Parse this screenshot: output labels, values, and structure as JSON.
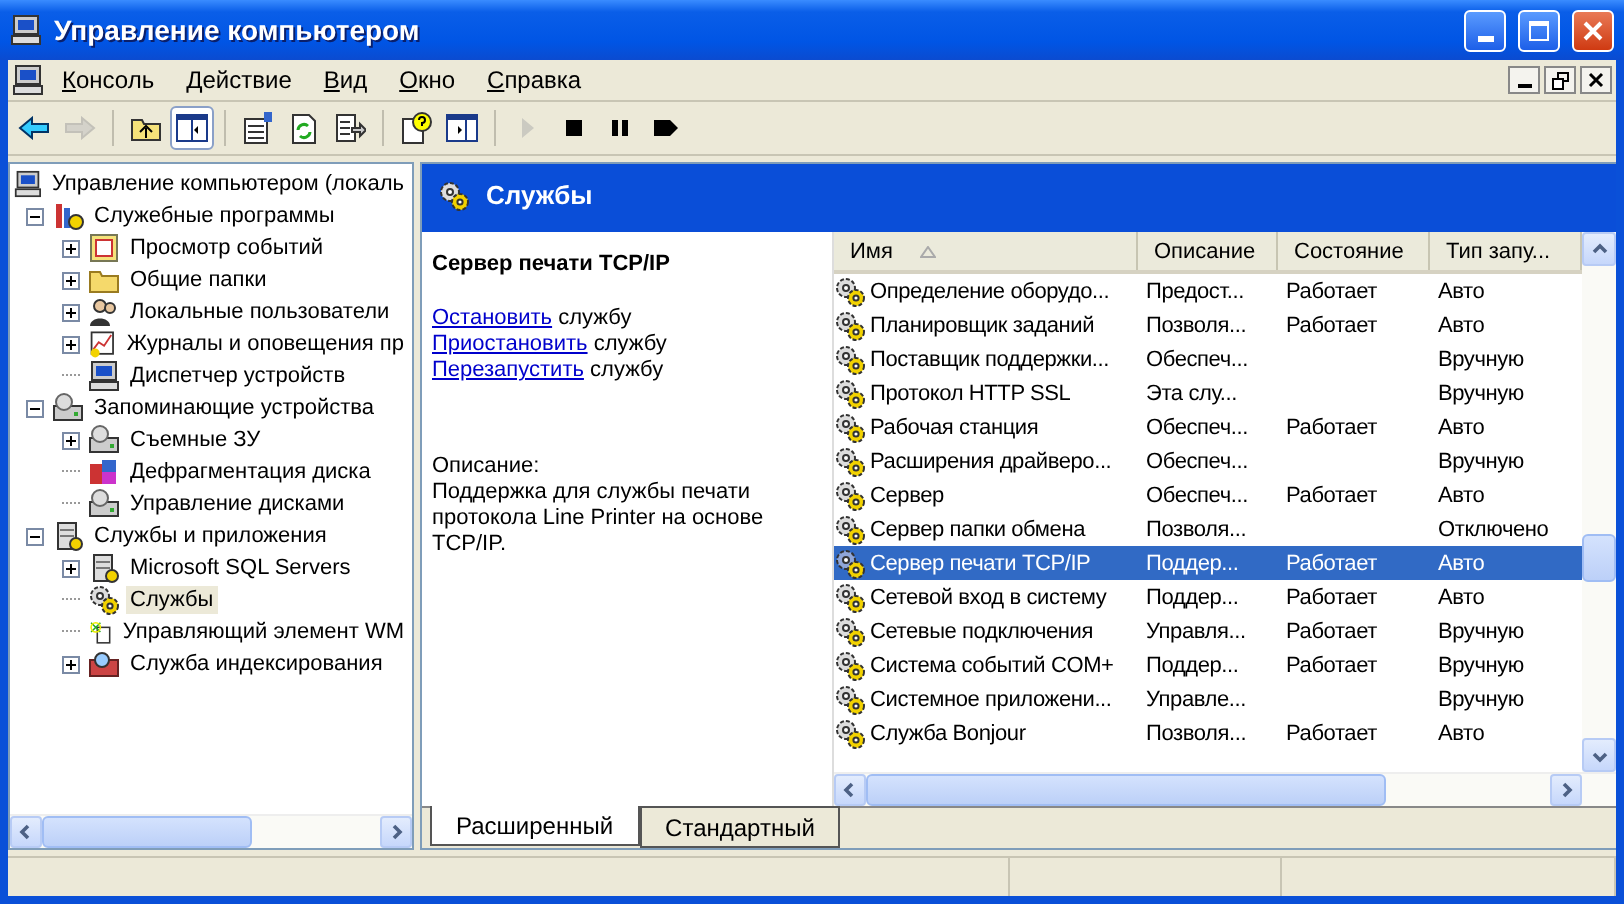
{
  "window": {
    "title": "Управление компьютером"
  },
  "menu": [
    "Консоль",
    "Действие",
    "Вид",
    "Окно",
    "Справка"
  ],
  "toolbar": [
    {
      "kind": "back",
      "disabled": false,
      "pressed": false
    },
    {
      "kind": "forward",
      "disabled": true,
      "pressed": false
    },
    {
      "kind": "sep"
    },
    {
      "kind": "up",
      "disabled": false,
      "pressed": false
    },
    {
      "kind": "tree",
      "disabled": false,
      "pressed": true
    },
    {
      "kind": "sep"
    },
    {
      "kind": "properties",
      "disabled": false,
      "pressed": false
    },
    {
      "kind": "refresh",
      "disabled": false,
      "pressed": false
    },
    {
      "kind": "export",
      "disabled": false,
      "pressed": false
    },
    {
      "kind": "sep"
    },
    {
      "kind": "help",
      "disabled": false,
      "pressed": false
    },
    {
      "kind": "pane",
      "disabled": false,
      "pressed": false
    },
    {
      "kind": "sep"
    },
    {
      "kind": "play",
      "disabled": true,
      "pressed": false
    },
    {
      "kind": "stop",
      "disabled": false,
      "pressed": false
    },
    {
      "kind": "pause",
      "disabled": false,
      "pressed": false
    },
    {
      "kind": "restart",
      "disabled": false,
      "pressed": false
    }
  ],
  "tree": [
    {
      "label": "Управление компьютером (локаль",
      "kind": "computer",
      "selected": false,
      "children": [
        {
          "label": "Служебные программы",
          "kind": "tools",
          "expanded": true,
          "selected": false,
          "children": [
            {
              "label": "Просмотр событий",
              "kind": "events",
              "expanded": false,
              "selected": false
            },
            {
              "label": "Общие папки",
              "kind": "folder",
              "expanded": false,
              "selected": false
            },
            {
              "label": "Локальные пользователи",
              "kind": "users",
              "expanded": false,
              "selected": false
            },
            {
              "label": "Журналы и оповещения пр",
              "kind": "logs",
              "expanded": false,
              "selected": false
            },
            {
              "label": "Диспетчер устройств",
              "kind": "devices",
              "selected": false
            }
          ]
        },
        {
          "label": "Запоминающие устройства",
          "kind": "storage",
          "expanded": true,
          "selected": false,
          "children": [
            {
              "label": "Съемные ЗУ",
              "kind": "removable",
              "expanded": false,
              "selected": false
            },
            {
              "label": "Дефрагментация диска",
              "kind": "defrag",
              "selected": false
            },
            {
              "label": "Управление дисками",
              "kind": "disks",
              "selected": false
            }
          ]
        },
        {
          "label": "Службы и приложения",
          "kind": "apps",
          "expanded": true,
          "selected": false,
          "children": [
            {
              "label": "Microsoft SQL Servers",
              "kind": "database",
              "expanded": false,
              "selected": false
            },
            {
              "label": "Службы",
              "kind": "gears",
              "selected": true
            },
            {
              "label": "Управляющий элемент WM",
              "kind": "wmi",
              "selected": false
            },
            {
              "label": "Служба индексирования",
              "kind": "index",
              "expanded": false,
              "selected": false
            }
          ]
        }
      ]
    }
  ],
  "pane": {
    "title": "Службы"
  },
  "details": {
    "service": "Сервер печати TCP/IP",
    "actions": [
      {
        "link": "Остановить",
        "text": "службу"
      },
      {
        "link": "Приостановить",
        "text": "службу"
      },
      {
        "link": "Перезапустить",
        "text": "службу"
      }
    ],
    "description_label": "Описание:",
    "description": "Поддержка для службы печати протокола Line Printer на основе TCP/IP."
  },
  "table": {
    "columns": [
      "Имя",
      "Описание",
      "Состояние",
      "Тип запу..."
    ],
    "rows": [
      {
        "cells": [
          "Определение оборудо...",
          "Предост...",
          "Работает",
          "Авто"
        ],
        "selected": false
      },
      {
        "cells": [
          "Планировщик заданий",
          "Позволя...",
          "Работает",
          "Авто"
        ],
        "selected": false
      },
      {
        "cells": [
          "Поставщик поддержки...",
          "Обеспеч...",
          "",
          "Вручную"
        ],
        "selected": false
      },
      {
        "cells": [
          "Протокол HTTP SSL",
          "Эта слу...",
          "",
          "Вручную"
        ],
        "selected": false
      },
      {
        "cells": [
          "Рабочая станция",
          "Обеспеч...",
          "Работает",
          "Авто"
        ],
        "selected": false
      },
      {
        "cells": [
          "Расширения драйверо...",
          "Обеспеч...",
          "",
          "Вручную"
        ],
        "selected": false
      },
      {
        "cells": [
          "Сервер",
          "Обеспеч...",
          "Работает",
          "Авто"
        ],
        "selected": false
      },
      {
        "cells": [
          "Сервер папки обмена",
          "Позволя...",
          "",
          "Отключено"
        ],
        "selected": false
      },
      {
        "cells": [
          "Сервер печати TCP/IP",
          "Поддер...",
          "Работает",
          "Авто"
        ],
        "selected": true
      },
      {
        "cells": [
          "Сетевой вход в систему",
          "Поддер...",
          "Работает",
          "Авто"
        ],
        "selected": false
      },
      {
        "cells": [
          "Сетевые подключения",
          "Управля...",
          "Работает",
          "Вручную"
        ],
        "selected": false
      },
      {
        "cells": [
          "Система событий COM+",
          "Поддер...",
          "Работает",
          "Вручную"
        ],
        "selected": false
      },
      {
        "cells": [
          "Системное приложени...",
          "Управле...",
          "",
          "Вручную"
        ],
        "selected": false
      },
      {
        "cells": [
          "Служба Bonjour",
          "Позволя...",
          "Работает",
          "Авто"
        ],
        "selected": false
      }
    ]
  },
  "tabs": [
    {
      "label": "Расширенный",
      "selected": true
    },
    {
      "label": "Стандартный",
      "selected": false
    }
  ]
}
